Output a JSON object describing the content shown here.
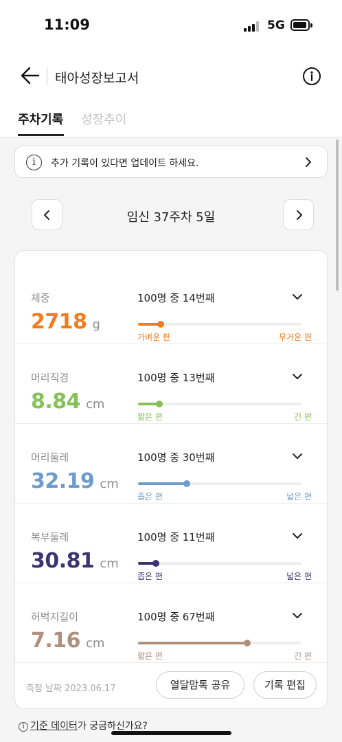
{
  "status": {
    "time": "11:09",
    "network": "5G"
  },
  "header": {
    "title": "태아성장보고서"
  },
  "tabs": [
    {
      "label": "주차기록",
      "active": true
    },
    {
      "label": "성장추이",
      "active": false
    }
  ],
  "notice": {
    "icon": "i",
    "text": "추가 기록이 있다면 업데이트 하세요."
  },
  "week": {
    "label": "임신 37주차 5일"
  },
  "metrics": [
    {
      "label": "체중",
      "value": "2718",
      "unit": "g",
      "rank": "100명 중 14번째",
      "percentile": 14,
      "left_label": "가벼운 편",
      "right_label": "무거운 편",
      "color": "#f27b1b"
    },
    {
      "label": "머리직경",
      "value": "8.84",
      "unit": "cm",
      "rank": "100명 중 13번째",
      "percentile": 13,
      "left_label": "짧은 편",
      "right_label": "긴 편",
      "color": "#86c157"
    },
    {
      "label": "머리둘레",
      "value": "32.19",
      "unit": "cm",
      "rank": "100명 중 30번째",
      "percentile": 30,
      "left_label": "좁은 편",
      "right_label": "넓은 편",
      "color": "#6e9bcc"
    },
    {
      "label": "복부둘레",
      "value": "30.81",
      "unit": "cm",
      "rank": "100명 중 11번째",
      "percentile": 11,
      "left_label": "좁은 편",
      "right_label": "넓은 편",
      "color": "#3b3470"
    },
    {
      "label": "허벅지길이",
      "value": "7.16",
      "unit": "cm",
      "rank": "100명 중 67번째",
      "percentile": 67,
      "left_label": "짧은 편",
      "right_label": "긴 편",
      "color": "#b08f7c"
    }
  ],
  "footer": {
    "measure_date": "측정 날짜 2023.06.17",
    "share_label": "열달맘톡 공유",
    "edit_label": "기록 편집"
  },
  "bottom": {
    "icon": "i",
    "link_text": "기준 데이터",
    "tail_text": "가 궁금하신가요?"
  }
}
